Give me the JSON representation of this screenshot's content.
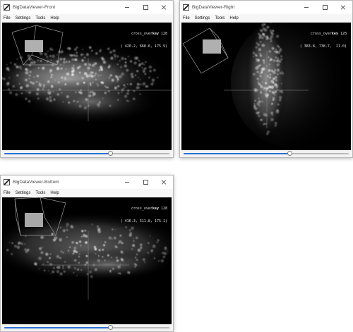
{
  "menu_labels": [
    "File",
    "Settings",
    "Tools",
    "Help"
  ],
  "windows": {
    "front": {
      "title": "BigDataViewer-Front",
      "overlay_line1_prefix": "cross_over",
      "overlay_line1_key": "key",
      "overlay_line1_suffix": " 128",
      "overlay_line2": "( 420.2, 668.6, 175.9)",
      "slider_fraction": 0.645
    },
    "right": {
      "title": "BigDataViewer-Right",
      "overlay_line1_prefix": "cross_over",
      "overlay_line1_key": "key",
      "overlay_line1_suffix": " 128",
      "overlay_line2": "( 383.8, 738.7,  21.0)",
      "slider_fraction": 0.645
    },
    "bottom": {
      "title": "BigDataViewer-Bottom",
      "overlay_line1_prefix": "cross_over",
      "overlay_line1_key": "key",
      "overlay_line1_suffix": " 128",
      "overlay_line2": "( 416.3, 511.8, 175.1)",
      "slider_fraction": 0.645
    }
  },
  "colors": {
    "slider_active": "#2a6fd4",
    "viewer_background": "#000000"
  }
}
